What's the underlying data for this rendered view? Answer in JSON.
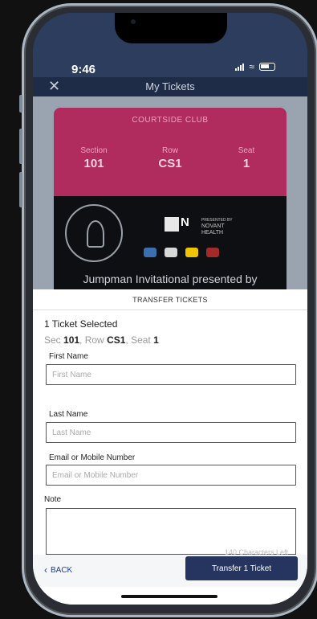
{
  "status_bar": {
    "time": "9:46"
  },
  "header": {
    "title": "My Tickets",
    "close_glyph": "✕"
  },
  "ticket": {
    "club": "COURTSIDE CLUB",
    "section_label": "Section",
    "section_value": "101",
    "row_label": "Row",
    "row_value": "CS1",
    "seat_label": "Seat",
    "seat_value": "1",
    "sponsor_label": "PRESENTED BY",
    "sponsor_name": "NOVANT",
    "sponsor_sub": "HEALTH",
    "sponsor_mark": "N",
    "event_name": "Jumpman Invitational presented by",
    "color": "#b02c5f"
  },
  "transfer": {
    "title": "TRANSFER TICKETS",
    "selected_text": "1 Ticket Selected",
    "sec_prefix": "Sec ",
    "sec_value": "101",
    "row_prefix": ", Row ",
    "row_value": "CS1",
    "seat_prefix": ", Seat ",
    "seat_value": "1",
    "first_name_label": "First Name",
    "first_name_placeholder": "First Name",
    "last_name_label": "Last Name",
    "last_name_placeholder": "Last Name",
    "contact_label": "Email or Mobile Number",
    "contact_placeholder": "Email or Mobile Number",
    "note_label": "Note",
    "char_count": "140 Characters Left",
    "back_label": "BACK",
    "submit_label": "Transfer 1 Ticket"
  },
  "colors": {
    "accent": "#25355f",
    "link": "#1e3c8a"
  }
}
